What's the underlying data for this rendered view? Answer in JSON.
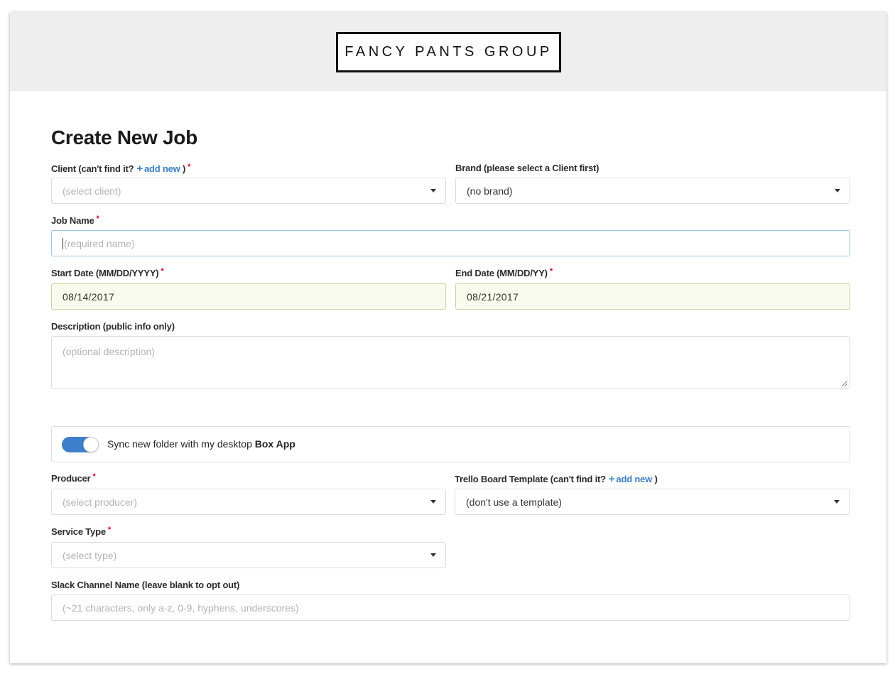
{
  "header": {
    "logo_text": "FANCY PANTS GROUP"
  },
  "page": {
    "title": "Create New Job"
  },
  "form": {
    "client": {
      "label": "Client (can't find it?",
      "plus": "+",
      "add_new": "add new",
      "close_paren": ")",
      "required": "*",
      "placeholder": "(select client)"
    },
    "brand": {
      "label": "Brand (please select a Client first)",
      "value": "(no brand)"
    },
    "job_name": {
      "label": "Job Name",
      "required": "*",
      "placeholder": "(required name)"
    },
    "start_date": {
      "label": "Start Date (MM/DD/YYYY)",
      "required": "*",
      "value": "08/14/2017"
    },
    "end_date": {
      "label": "End Date (MM/DD/YY)",
      "required": "*",
      "value": "08/21/2017"
    },
    "description": {
      "label": "Description (public info only)",
      "placeholder": "(optional description)"
    },
    "sync": {
      "text": "Sync new folder with my desktop",
      "app_name": "Box App",
      "enabled": true
    },
    "producer": {
      "label": "Producer",
      "required": "*",
      "placeholder": "(select producer)"
    },
    "trello": {
      "label": "Trello Board Template (can't find it?",
      "plus": "+",
      "add_new": "add new",
      "close_paren": ")",
      "value": "(don't use a template)"
    },
    "service_type": {
      "label": "Service Type",
      "required": "*",
      "placeholder": "(select type)"
    },
    "slack": {
      "label": "Slack Channel Name (leave blank to opt out)",
      "placeholder": "(~21 characters, only a-z, 0-9, hyphens, underscores)"
    }
  },
  "colors": {
    "accent": "#3b7fc4",
    "required": "#d0021b",
    "toggle_on": "#3d7fca",
    "header_bg": "#eeeeee"
  }
}
